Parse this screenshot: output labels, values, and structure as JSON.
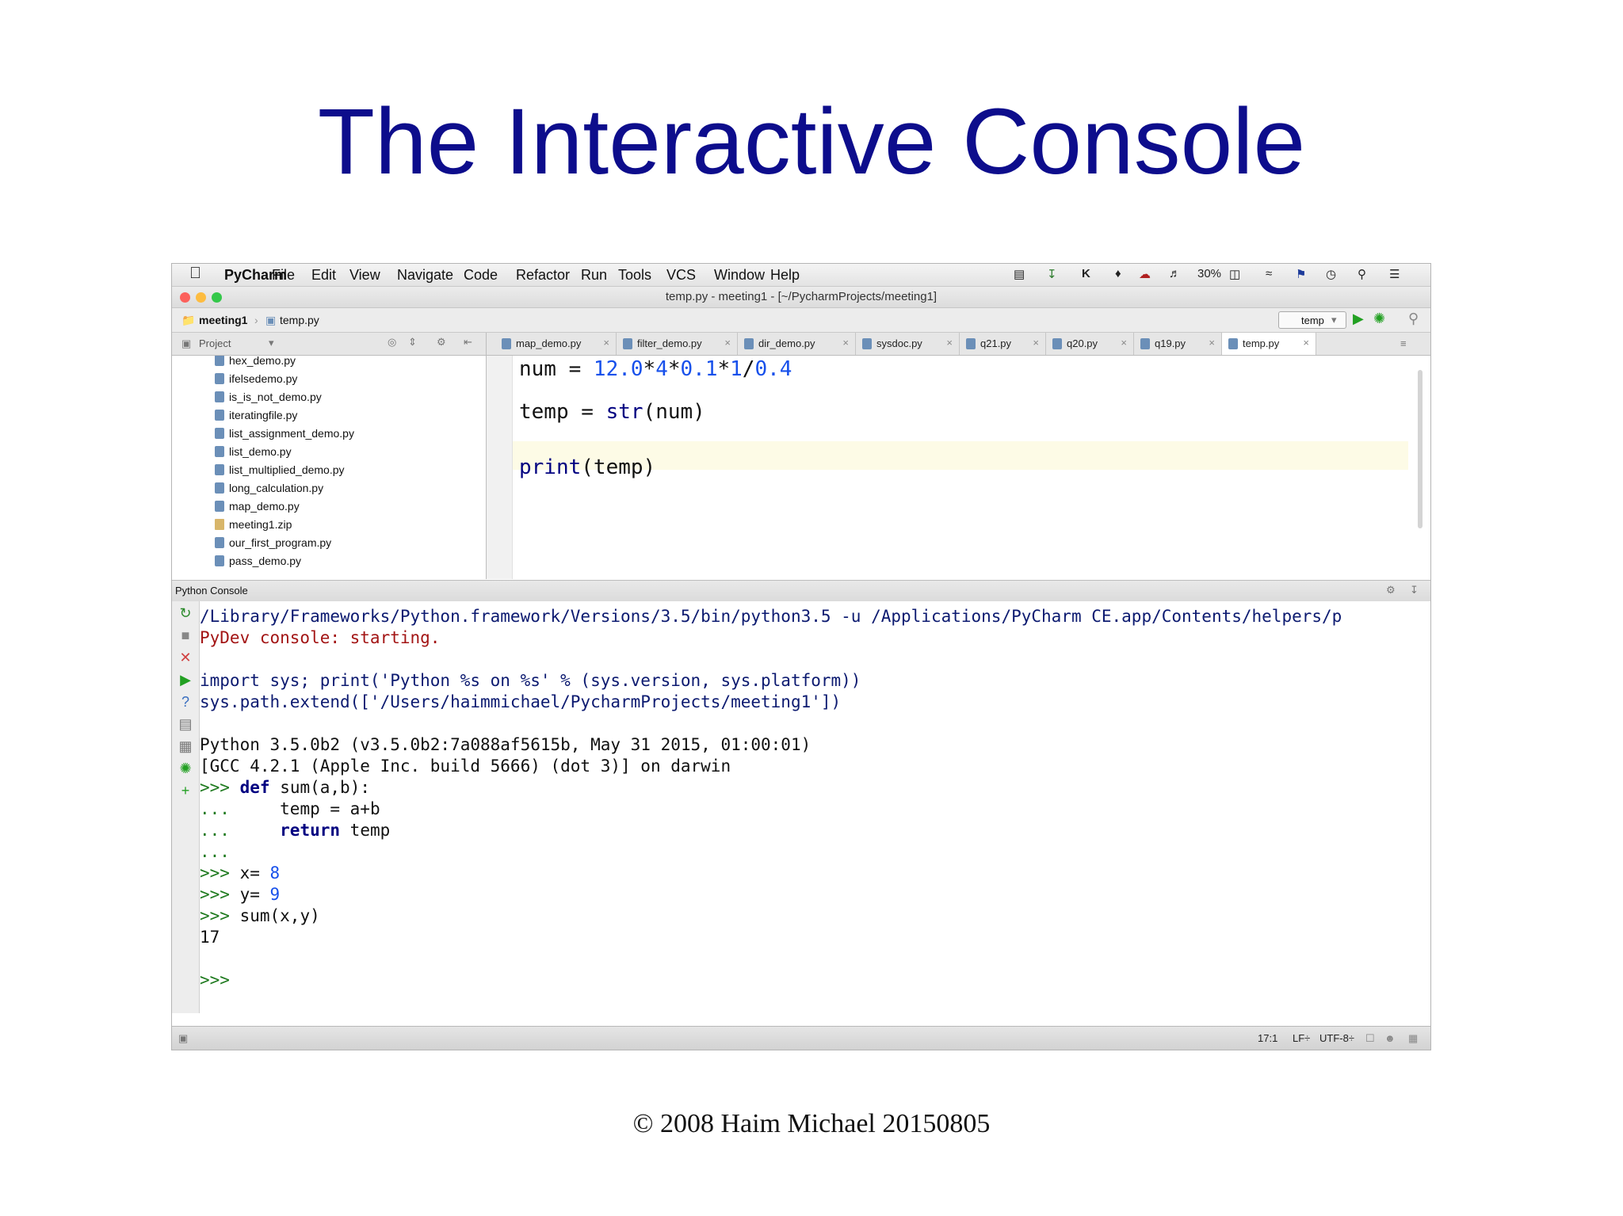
{
  "slide": {
    "title": "The Interactive Console",
    "footer": "© 2008 Haim Michael 20150805"
  },
  "menubar": {
    "app_name": "PyCharm",
    "menus": [
      "File",
      "Edit",
      "View",
      "Navigate",
      "Code",
      "Refactor",
      "Run",
      "Tools",
      "VCS",
      "Window",
      "Help"
    ],
    "battery": "30%"
  },
  "window": {
    "title": "temp.py - meeting1 - [~/PycharmProjects/meeting1]",
    "lights": [
      "#fc605b",
      "#fdbc40",
      "#34c84a"
    ]
  },
  "navbar": {
    "breadcrumbs": [
      "meeting1",
      "temp.py"
    ],
    "run_config": "temp"
  },
  "project_panel": {
    "label": "Project",
    "files": [
      "hex_demo.py",
      "ifelsedemo.py",
      "is_is_not_demo.py",
      "iteratingfile.py",
      "list_assignment_demo.py",
      "list_demo.py",
      "list_multiplied_demo.py",
      "long_calculation.py",
      "map_demo.py",
      "meeting1.zip",
      "our_first_program.py",
      "pass_demo.py"
    ]
  },
  "tabs": [
    "map_demo.py",
    "filter_demo.py",
    "dir_demo.py",
    "sysdoc.py",
    "q21.py",
    "q20.py",
    "q19.py",
    "temp.py"
  ],
  "active_tab": "temp.py",
  "editor": {
    "line1": {
      "lhs": "num = ",
      "n1": "12.0",
      "op1": "*",
      "n2": "4",
      "op2": "*",
      "n3": "0.1",
      "op3": "*",
      "n4": "1",
      "op4": "/",
      "n5": "0.4"
    },
    "line2": {
      "lhs": "temp = ",
      "fn": "str",
      "args": "(num)"
    },
    "line3": {
      "fn": "print",
      "args": "(temp)"
    }
  },
  "console": {
    "header": "Python Console",
    "cmd": "/Library/Frameworks/Python.framework/Versions/3.5/bin/python3.5 -u /Applications/PyCharm CE.app/Contents/helpers/p",
    "starting": "PyDev console: starting.",
    "import_line": "import sys; print('Python %s on %s' % (sys.version, sys.platform))",
    "path_line": "sys.path.extend(['/Users/haimmichael/PycharmProjects/meeting1'])",
    "version_line": "Python 3.5.0b2 (v3.5.0b2:7a088af5615b, May 31 2015, 01:00:01)",
    "gcc_line": "[GCC 4.2.1 (Apple Inc. build 5666) (dot 3)] on darwin",
    "prompt": ">>>",
    "cont": "...",
    "def_kw": "def",
    "def_rest": "sum(a,b):",
    "body1": "temp = a+b",
    "return_kw": "return",
    "body2": "temp",
    "x_assign": "x= ",
    "x_val": "8",
    "y_assign": "y= ",
    "y_val": "9",
    "call": "sum(x,y)",
    "result": "17"
  },
  "statusbar": {
    "position": "17:1",
    "line_sep": "LF÷",
    "encoding": "UTF-8÷"
  }
}
